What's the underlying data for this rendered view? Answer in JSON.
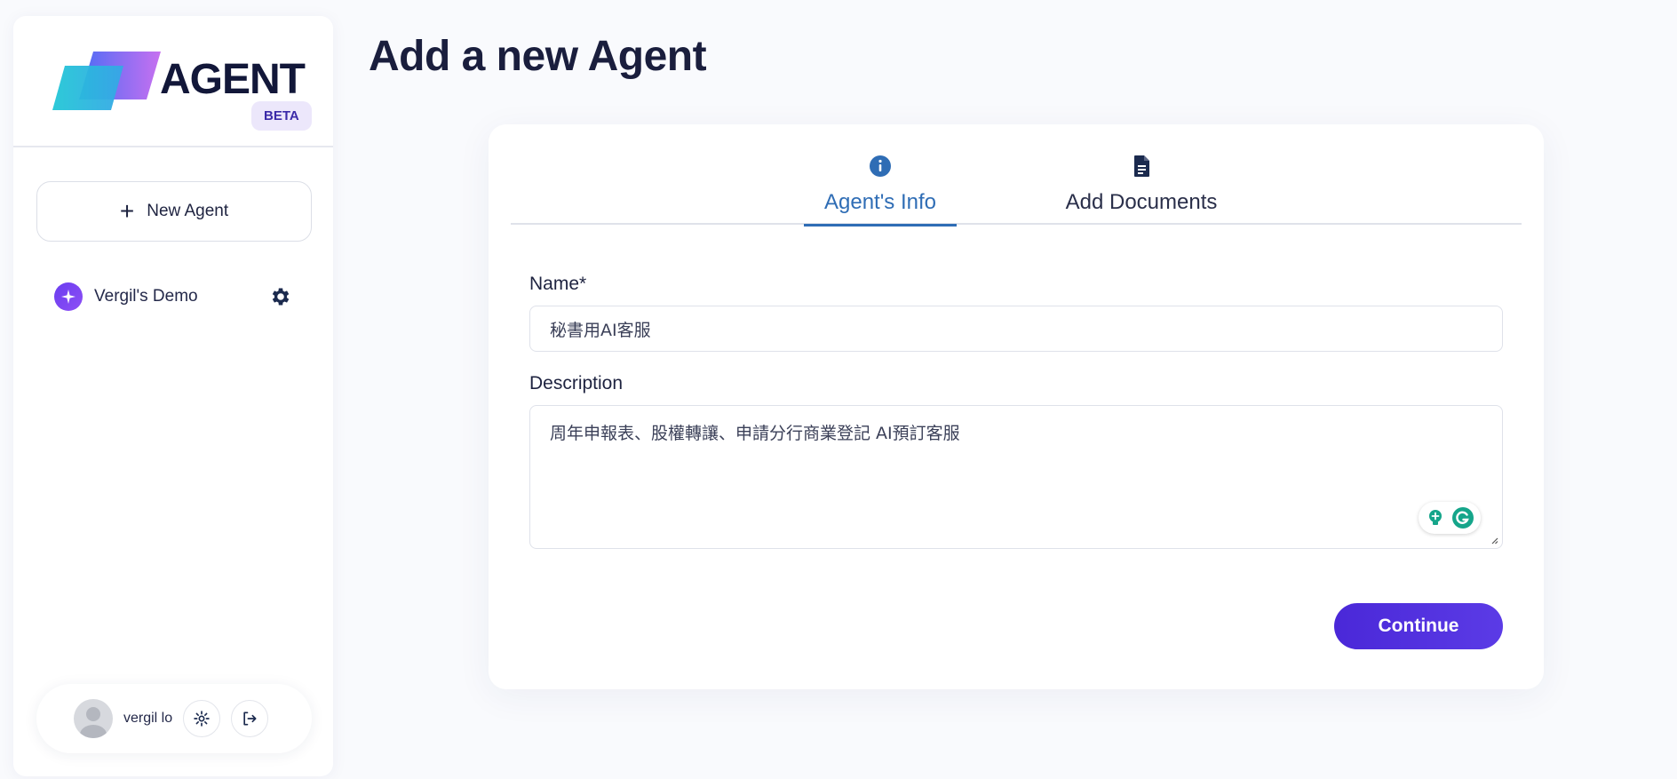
{
  "brand": {
    "name": "AGENT",
    "badge": "BETA"
  },
  "sidebar": {
    "new_agent_label": "New Agent",
    "agents": [
      {
        "name": "Vergil's Demo"
      }
    ],
    "user": {
      "name": "vergil lo"
    }
  },
  "page": {
    "title": "Add a new Agent"
  },
  "tabs": [
    {
      "label": "Agent's Info",
      "icon": "info-icon",
      "active": true
    },
    {
      "label": "Add Documents",
      "icon": "document-icon",
      "active": false
    }
  ],
  "form": {
    "name_label": "Name*",
    "name_value": "秘書用AI客服",
    "description_label": "Description",
    "description_value": "周年申報表、股權轉讓、申請分行商業登記 AI預訂客服"
  },
  "continue_label": "Continue",
  "colors": {
    "accent": "#4a28d8",
    "active_tab": "#2f6db5",
    "title": "#1a1e3d"
  }
}
